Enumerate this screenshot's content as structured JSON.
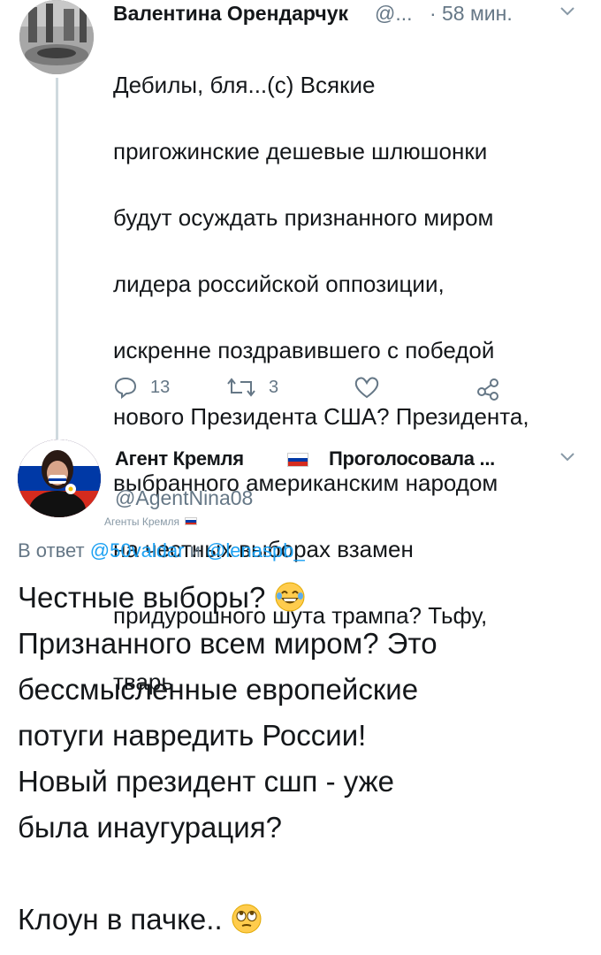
{
  "tweet1": {
    "author_name": "Валентина Орендарчук",
    "author_handle": "@...",
    "separator": "·",
    "time": "58 мин.",
    "text_lines": [
      "Дебилы, бля...(с) Всякие",
      "пригожинские дешевые шлюшонки",
      "будут осуждать признанного миром",
      "лидера российской оппозиции,",
      "искренне поздравившего с победой",
      "нового Президента США? Президента,",
      "выбранного американским народом",
      "на честных выборах взамен",
      "придурошного шута трампа? Тьфу,",
      "тварь"
    ],
    "reply_count": "13",
    "retweet_count": "3"
  },
  "tweet2": {
    "author_name": "Агент Кремля",
    "author_name_suffix": "Проголосовала ...",
    "author_handle": "@AgentNina08",
    "badge_label": "Агенты Кремля",
    "replying_prefix": "В ответ",
    "replying_to_1": "@50valdar",
    "replying_and": "и",
    "replying_to_2": "@lenaspb_",
    "text_lines": [
      "Честные выборы?",
      "Признанного всем миром? Это",
      "бессмысленные европейские",
      "потуги навредить России!",
      "Новый президент сшп - уже",
      "была инаугурация?",
      "",
      "Клоун в пачке.."
    ]
  },
  "colors": {
    "text": "#14171a",
    "muted": "#657786",
    "link": "#1da1f2",
    "thread_line": "#cfd9de",
    "flag_white": "#ffffff",
    "flag_blue": "#0039a6",
    "flag_red": "#d52b1e"
  },
  "icons": [
    "reply-icon",
    "retweet-icon",
    "like-icon",
    "share-icon",
    "chevron-down-icon",
    "laughing-emoji-icon",
    "eye-roll-emoji-icon"
  ]
}
